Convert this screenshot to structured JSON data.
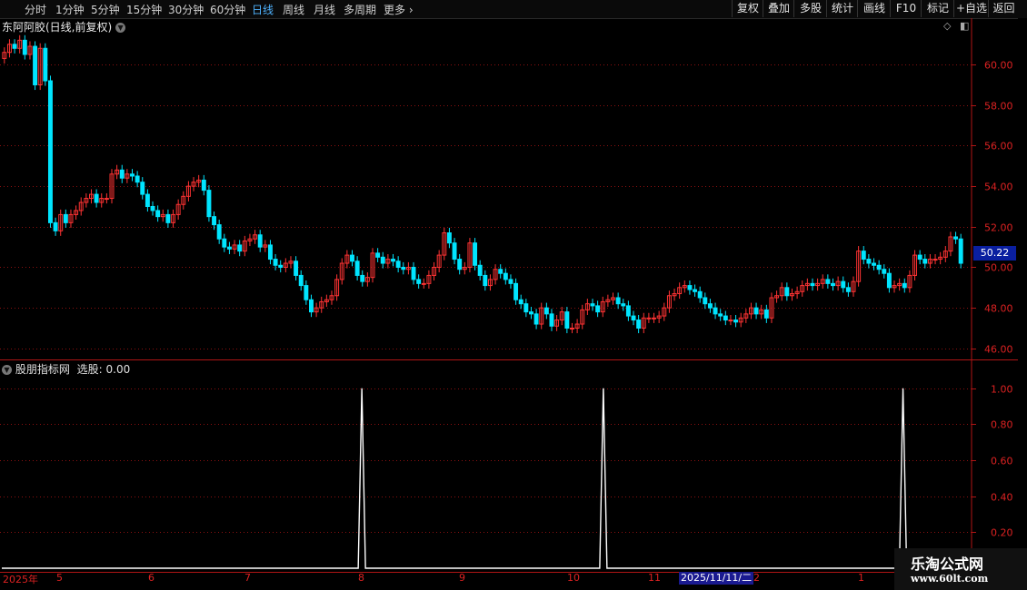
{
  "toolbar": {
    "periods": [
      "分时",
      "1分钟",
      "5分钟",
      "15分钟",
      "30分钟",
      "60分钟",
      "日线",
      "周线",
      "月线",
      "多周期",
      "更多"
    ],
    "active": "日线",
    "right_buttons": [
      "复权",
      "叠加",
      "多股",
      "统计",
      "画线",
      "F10",
      "标记",
      "+自选",
      "返回"
    ]
  },
  "stock": {
    "title": "东阿阿胶(日线,前复权)",
    "last_price": "50.22"
  },
  "indicator": {
    "title": "股朋指标网",
    "value_label": "选股: 0.00"
  },
  "dates": {
    "labels": [
      "2025年",
      "5",
      "6",
      "7",
      "8",
      "9",
      "10",
      "11",
      "2",
      "1"
    ],
    "cursor": "2025/11/11/二"
  },
  "watermark": {
    "title": "乐淘公式网",
    "url": "www.60lt.com"
  },
  "colors": {
    "up": "#ff3333",
    "down": "#00e5ff",
    "grid": "#8a1010",
    "indicator_line": "#ffffff"
  },
  "chart_data": [
    {
      "type": "candlestick",
      "title": "东阿阿胶(日线,前复权)",
      "ylim": [
        45.5,
        62.2
      ],
      "yticks": [
        46.0,
        48.0,
        50.0,
        52.0,
        54.0,
        56.0,
        58.0,
        60.0
      ],
      "closes": [
        60.6,
        61.0,
        60.8,
        61.2,
        60.5,
        60.9,
        59.0,
        60.8,
        59.2,
        52.2,
        51.8,
        52.6,
        52.2,
        52.6,
        52.8,
        53.2,
        53.4,
        53.6,
        53.2,
        53.4,
        53.4,
        54.6,
        54.8,
        54.4,
        54.6,
        54.5,
        54.2,
        53.6,
        53.0,
        52.8,
        52.5,
        52.6,
        52.2,
        52.6,
        53.1,
        53.5,
        54.0,
        54.2,
        54.3,
        53.8,
        52.5,
        52.1,
        51.4,
        51.0,
        50.9,
        51.1,
        50.8,
        51.3,
        51.4,
        51.6,
        51.0,
        51.1,
        50.4,
        50.1,
        50.0,
        50.2,
        50.3,
        49.6,
        49.1,
        48.4,
        47.8,
        48.0,
        48.3,
        48.4,
        48.6,
        49.4,
        50.2,
        50.6,
        50.3,
        49.6,
        49.3,
        49.5,
        50.7,
        50.5,
        50.2,
        50.4,
        50.3,
        50.0,
        49.9,
        50.0,
        49.4,
        49.2,
        49.2,
        49.6,
        50.0,
        50.6,
        51.7,
        51.2,
        50.4,
        49.9,
        50.0,
        51.2,
        50.1,
        49.6,
        49.1,
        49.4,
        49.9,
        49.7,
        49.4,
        49.2,
        48.4,
        48.2,
        47.8,
        47.7,
        47.2,
        48.0,
        47.7,
        47.1,
        47.4,
        47.8,
        47.0,
        47.0,
        47.2,
        47.9,
        48.2,
        48.1,
        47.8,
        48.3,
        48.4,
        48.5,
        48.2,
        48.1,
        47.6,
        47.4,
        47.0,
        47.5,
        47.5,
        47.5,
        47.6,
        48.0,
        48.6,
        48.7,
        49.0,
        49.1,
        48.9,
        48.8,
        48.5,
        48.2,
        48.0,
        47.7,
        47.6,
        47.4,
        47.4,
        47.3,
        47.5,
        47.7,
        48.0,
        47.7,
        47.9,
        47.5,
        48.5,
        48.6,
        49.0,
        48.6,
        48.7,
        48.8,
        49.1,
        49.2,
        49.1,
        49.2,
        49.4,
        49.2,
        49.1,
        49.3,
        49.0,
        48.8,
        49.3,
        50.8,
        50.4,
        50.2,
        50.1,
        49.9,
        49.7,
        49.0,
        49.1,
        49.2,
        49.0,
        49.6,
        50.6,
        50.4,
        50.2,
        50.4,
        50.4,
        50.5,
        50.8,
        51.5,
        51.4,
        50.2
      ]
    },
    {
      "type": "line",
      "title": "股朋指标网",
      "ylim": [
        0,
        1.1
      ],
      "yticks": [
        0.2,
        0.4,
        0.6,
        0.8,
        1.0
      ],
      "signal_indices": [
        80,
        134,
        201
      ],
      "count": 215
    }
  ]
}
